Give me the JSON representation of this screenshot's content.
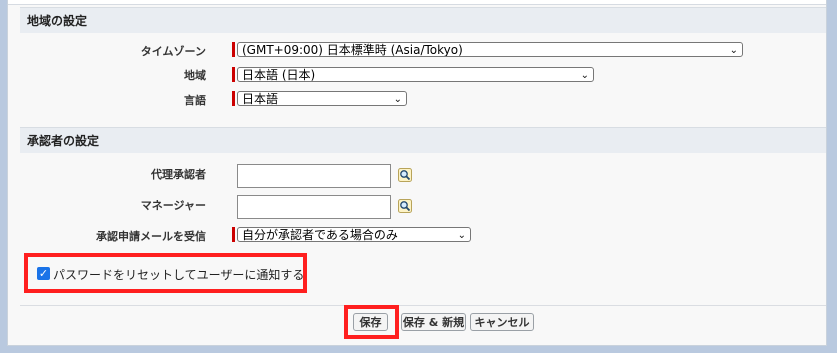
{
  "locale_section": {
    "title": "地域の設定",
    "timezone_label": "タイムゾーン",
    "timezone_value": "(GMT+09:00) 日本標準時 (Asia/Tokyo)",
    "region_label": "地域",
    "region_value": "日本語 (日本)",
    "language_label": "言語",
    "language_value": "日本語"
  },
  "approver_section": {
    "title": "承認者の設定",
    "delegate_label": "代理承認者",
    "delegate_value": "",
    "manager_label": "マネージャー",
    "manager_value": "",
    "email_label": "承認申請メールを受信",
    "email_value": "自分が承認者である場合のみ"
  },
  "notify": {
    "label": "パスワードをリセットしてユーザーに通知する",
    "checked": true
  },
  "buttons": {
    "save": "保存",
    "save_new": "保存 & 新規",
    "cancel": "キャンセル"
  },
  "colors": {
    "required_bar": "#cc0000",
    "highlight": "#ff1f1f",
    "checkbox": "#1a73e8"
  }
}
